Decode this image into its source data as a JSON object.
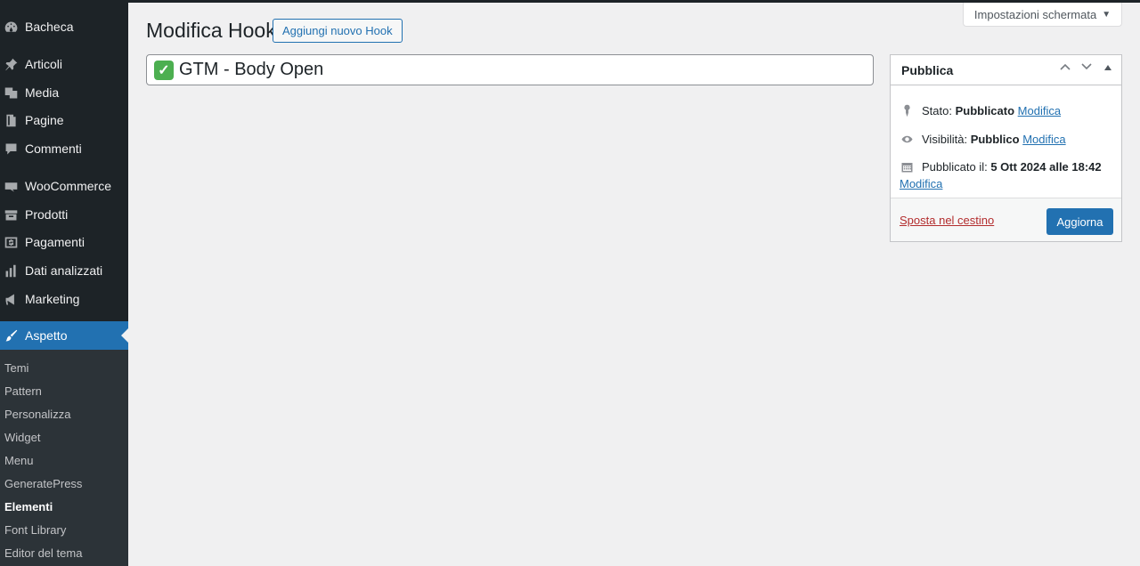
{
  "sidebar": {
    "items": [
      {
        "label": "Bacheca",
        "icon": "dashboard-icon"
      },
      {
        "label": "Articoli",
        "icon": "pin-icon"
      },
      {
        "label": "Media",
        "icon": "media-icon"
      },
      {
        "label": "Pagine",
        "icon": "page-icon"
      },
      {
        "label": "Commenti",
        "icon": "comment-icon"
      },
      {
        "label": "WooCommerce",
        "icon": "woo-icon"
      },
      {
        "label": "Prodotti",
        "icon": "archive-icon"
      },
      {
        "label": "Pagamenti",
        "icon": "dollar-icon"
      },
      {
        "label": "Dati analizzati",
        "icon": "chart-bar-icon"
      },
      {
        "label": "Marketing",
        "icon": "megaphone-icon"
      },
      {
        "label": "Aspetto",
        "icon": "brush-icon",
        "active": true
      }
    ],
    "submenu": [
      "Temi",
      "Pattern",
      "Personalizza",
      "Widget",
      "Menu",
      "GeneratePress",
      "Elementi",
      "Font Library",
      "Editor del tema"
    ],
    "submenu_current": "Elementi"
  },
  "header": {
    "title": "Modifica Hook",
    "add_new_label": "Aggiungi nuovo Hook",
    "screen_options_label": "Impostazioni schermata",
    "screen_options_arrow": "▼"
  },
  "post": {
    "title": "GTM - Body Open",
    "title_emoji": "✓"
  },
  "publish_box": {
    "title": "Pubblica",
    "status_label": "Stato:",
    "status_value": "Pubblicato",
    "visibility_label": "Visibilità:",
    "visibility_value": "Pubblico",
    "published_label": "Pubblicato il:",
    "published_value": "5 Ott 2024 alle 18:42",
    "edit_label": "Modifica",
    "trash_label": "Sposta nel cestino",
    "update_label": "Aggiorna"
  },
  "colors": {
    "sidebar_bg": "#1d2327",
    "accent": "#2271b1",
    "trash": "#b32d2e",
    "page_bg": "#f0f0f1"
  }
}
